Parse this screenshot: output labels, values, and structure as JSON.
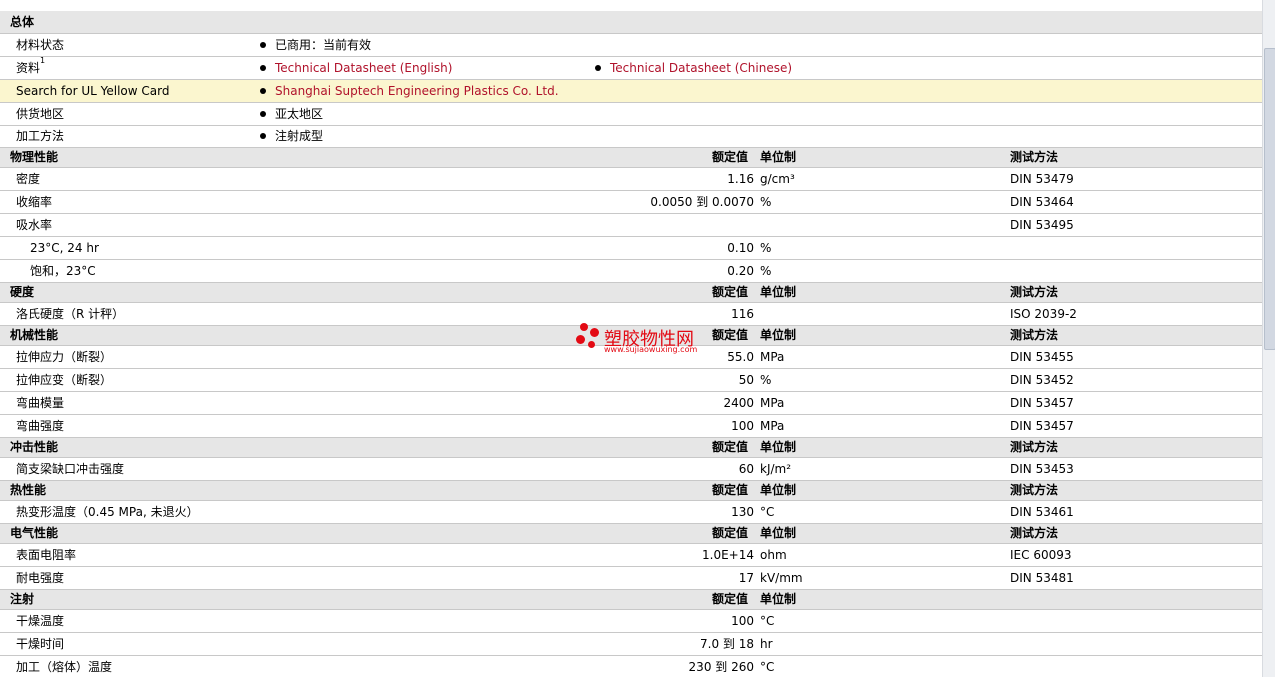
{
  "general": {
    "title": "总体",
    "material_status": {
      "label": "材料状态",
      "value": "已商用：当前有效"
    },
    "documents": {
      "label": "资料",
      "sup": "1",
      "link1": "Technical Datasheet (English)",
      "link2": "Technical Datasheet (Chinese)"
    },
    "ul": {
      "label": "Search for UL Yellow Card",
      "value": "Shanghai Suptech Engineering Plastics Co. Ltd."
    },
    "supply_region": {
      "label": "供货地区",
      "value": "亚太地区"
    },
    "processing": {
      "label": "加工方法",
      "value": "注射成型"
    }
  },
  "headers": {
    "rated": "额定值",
    "unit": "单位制",
    "method": "测试方法"
  },
  "physical": {
    "title": "物理性能",
    "rows": [
      {
        "label": "密度",
        "value": "1.16",
        "unit": "g/cm³",
        "method": "DIN 53479"
      },
      {
        "label": "收缩率",
        "value": "0.0050 到  0.0070",
        "unit": "%",
        "method": "DIN 53464"
      },
      {
        "label": "吸水率",
        "value": "",
        "unit": "",
        "method": "DIN 53495"
      },
      {
        "label": "23°C, 24 hr",
        "value": "0.10",
        "unit": "%",
        "method": ""
      },
      {
        "label": "饱和，23°C",
        "value": "0.20",
        "unit": "%",
        "method": ""
      }
    ]
  },
  "hardness": {
    "title": "硬度",
    "rows": [
      {
        "label": "洛氏硬度（R 计秤）",
        "value": "116",
        "unit": "",
        "method": "ISO 2039-2"
      }
    ]
  },
  "mechanical": {
    "title": "机械性能",
    "rows": [
      {
        "label": "拉伸应力（断裂）",
        "value": "55.0",
        "unit": "MPa",
        "method": "DIN 53455"
      },
      {
        "label": "拉伸应变（断裂）",
        "value": "50",
        "unit": "%",
        "method": "DIN 53452"
      },
      {
        "label": "弯曲模量",
        "value": "2400",
        "unit": "MPa",
        "method": "DIN 53457"
      },
      {
        "label": "弯曲强度",
        "value": "100",
        "unit": "MPa",
        "method": "DIN 53457"
      }
    ]
  },
  "impact": {
    "title": "冲击性能",
    "rows": [
      {
        "label": "简支梁缺口冲击强度",
        "value": "60",
        "unit": "kJ/m²",
        "method": "DIN 53453"
      }
    ]
  },
  "thermal": {
    "title": "热性能",
    "rows": [
      {
        "label": "热变形温度（0.45 MPa, 未退火）",
        "value": "130",
        "unit": "°C",
        "method": "DIN 53461"
      }
    ]
  },
  "electrical": {
    "title": "电气性能",
    "rows": [
      {
        "label": "表面电阻率",
        "value": "1.0E+14",
        "unit": "ohm",
        "method": "IEC 60093"
      },
      {
        "label": "耐电强度",
        "value": "17",
        "unit": "kV/mm",
        "method": "DIN 53481"
      }
    ]
  },
  "injection": {
    "title": "注射",
    "rows": [
      {
        "label": "干燥温度",
        "value": "100",
        "unit": "°C"
      },
      {
        "label": "干燥时间",
        "value": "7.0 到  18",
        "unit": "hr"
      },
      {
        "label": "加工（熔体）温度",
        "value": "230 到  260",
        "unit": "°C"
      }
    ]
  },
  "watermark": {
    "name": "塑胶物性网",
    "url": "www.sujiaowuxing.com"
  },
  "colors": {
    "section_bg": "#e6e6e6",
    "highlight_bg": "#fbf6cf",
    "link": "#b0122b",
    "watermark": "#e30a14"
  }
}
